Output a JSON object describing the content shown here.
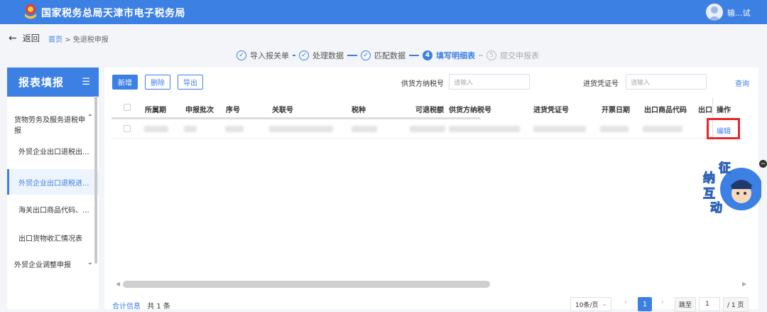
{
  "header": {
    "title": "国家税务总局天津市电子税务局",
    "user": "输...试"
  },
  "nav": {
    "back_label": "返回",
    "breadcrumb": [
      "首页",
      "免退税申报"
    ],
    "breadcrumb_sep": ">"
  },
  "steps": [
    {
      "num": "✓",
      "label": "导入报关单",
      "state": "done"
    },
    {
      "num": "✓",
      "label": "处理数据",
      "state": "done"
    },
    {
      "num": "✓",
      "label": "匹配数据",
      "state": "done"
    },
    {
      "num": "4",
      "label": "填写明细表",
      "state": "active"
    },
    {
      "num": "5",
      "label": "提交申报表",
      "state": "todo"
    }
  ],
  "sidebar": {
    "title": "报表填报",
    "groups": [
      {
        "label": "货物劳务及服务退税申报",
        "expanded": true,
        "items": [
          {
            "label": "外贸企业出口退税出...",
            "active": false
          },
          {
            "label": "外贸企业出口退税进...",
            "active": true
          },
          {
            "label": "海关出口商品代码、...",
            "active": false
          },
          {
            "label": "出口货物收汇情况表",
            "active": false
          }
        ]
      },
      {
        "label": "外贸企业调整申报",
        "expanded": false,
        "items": []
      }
    ]
  },
  "toolbar": {
    "add_label": "新增",
    "delete_label": "删除",
    "export_label": "导出",
    "supplier_tax_label": "供货方纳税号",
    "supplier_tax_placeholder": "请输入",
    "voucher_label": "进货凭证号",
    "voucher_placeholder": "请输入",
    "query_label": "查询"
  },
  "table": {
    "columns": [
      "所属期",
      "申报批次",
      "序号",
      "关联号",
      "税种",
      "可退税额",
      "供货方纳税号",
      "进货凭证号",
      "开票日期",
      "出口商品代码",
      "出口",
      "操作"
    ],
    "rows": [
      {
        "action": "编辑"
      }
    ]
  },
  "footer": {
    "summary_link": "合计信息",
    "total_text": "共 1 条",
    "page_size": "10条/页",
    "current_page": "1",
    "jump_label": "跳至",
    "jump_value": "1",
    "total_pages": "/ 1 页"
  },
  "mascot": {
    "chars": [
      "征",
      "纳",
      "互",
      "动"
    ]
  },
  "colors": {
    "primary": "#3d80e4",
    "highlight_border": "#e8262b"
  }
}
